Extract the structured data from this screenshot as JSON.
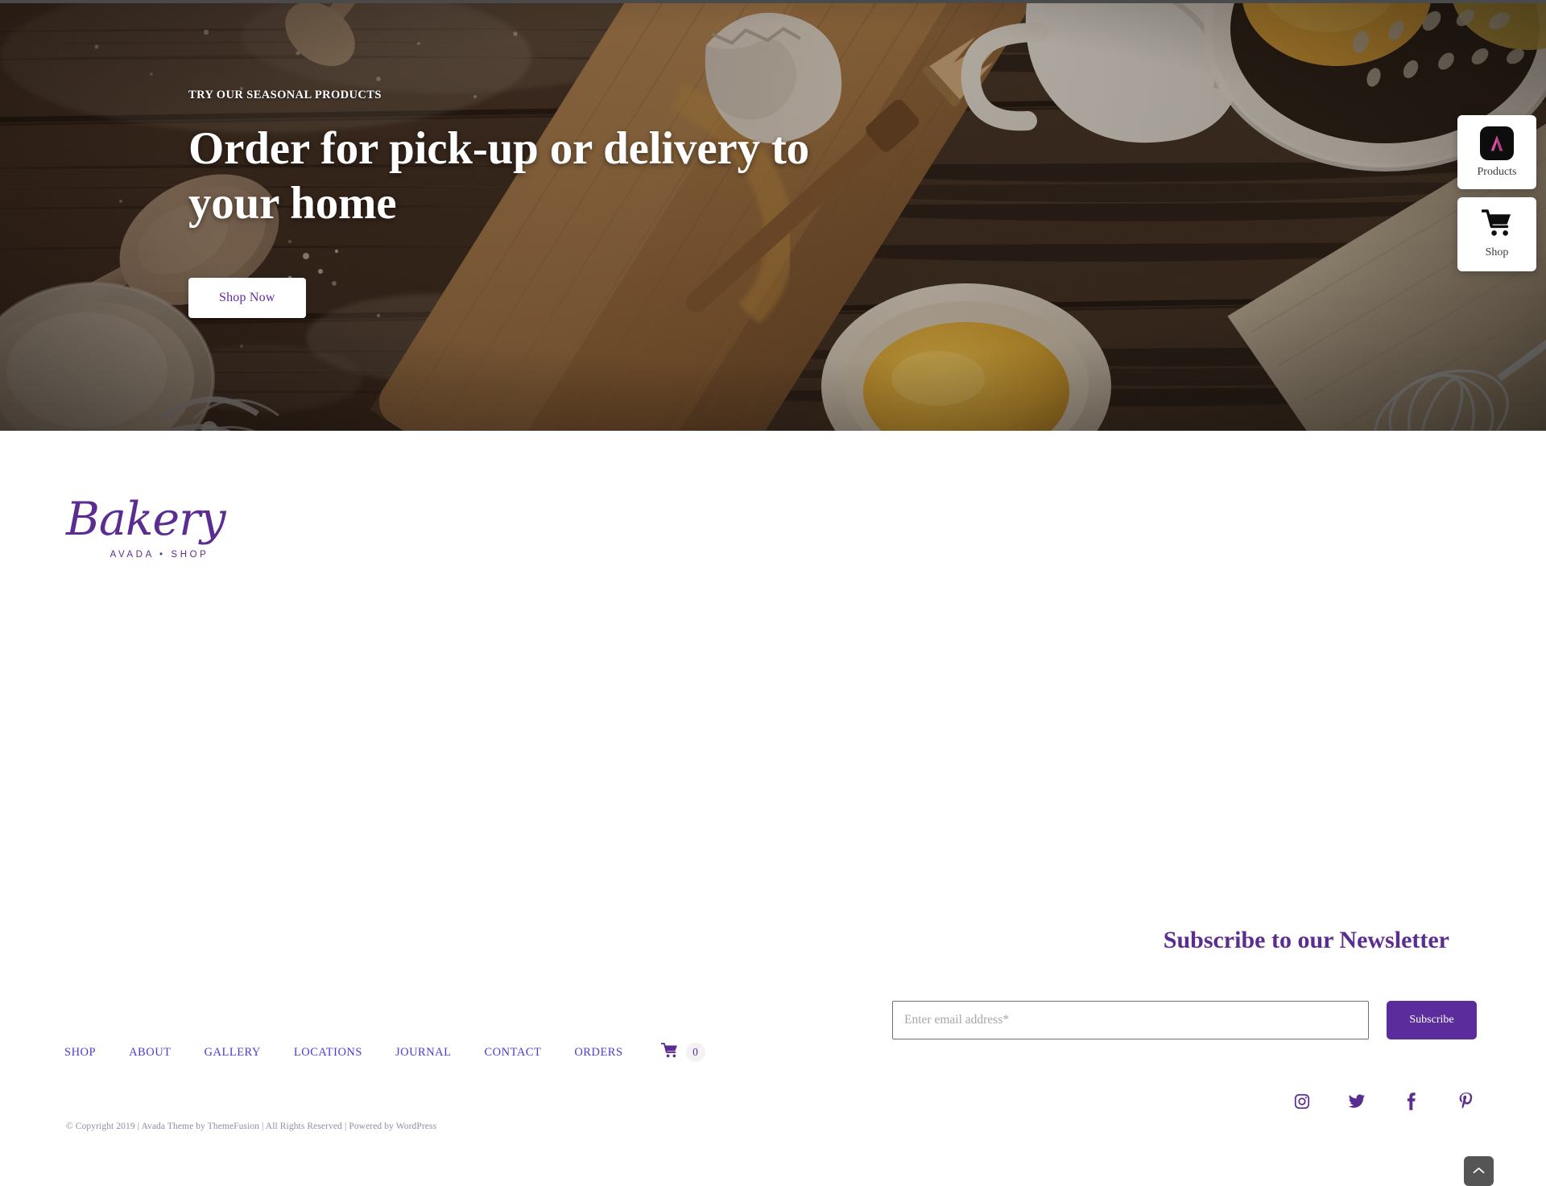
{
  "hero": {
    "eyebrow": "TRY OUR SEASONAL PRODUCTS",
    "title": "Order for pick-up or delivery to your home",
    "cta_label": "Shop Now",
    "background_description": "Dark rustic wooden table dusted with flour, wooden spoons, bamboo cutting board with pastry brush, cracked egg shell, bowl of egg yolk, glass flour jar, linen napkin, wire whisk and a colander with citrus"
  },
  "float_cards": [
    {
      "label": "Products",
      "icon": "avada-logo-icon"
    },
    {
      "label": "Shop",
      "icon": "shopping-cart-icon"
    }
  ],
  "footer": {
    "brand": {
      "name": "Bakery",
      "tagline": "AVADA • SHOP"
    },
    "nav": [
      {
        "label": "SHOP"
      },
      {
        "label": "ABOUT"
      },
      {
        "label": "GALLERY"
      },
      {
        "label": "LOCATIONS"
      },
      {
        "label": "JOURNAL"
      },
      {
        "label": "CONTACT"
      },
      {
        "label": "ORDERS"
      }
    ],
    "cart": {
      "icon": "shopping-cart-icon",
      "count": "0"
    },
    "copyright": "© Copyright 2019 | Avada Theme by ThemeFusion | All Rights Reserved | Powered by WordPress",
    "newsletter": {
      "heading": "Subscribe to our Newsletter",
      "placeholder": "Enter email address*",
      "button_label": "Subscribe"
    },
    "socials": [
      {
        "name": "instagram-icon"
      },
      {
        "name": "twitter-icon"
      },
      {
        "name": "facebook-icon"
      },
      {
        "name": "pinterest-icon"
      }
    ],
    "to_top": {
      "icon": "chevron-up-icon"
    }
  },
  "colors": {
    "brand_purple": "#5b2d90",
    "button_purple": "#5b2d9c",
    "nav_link": "#4a3bd6",
    "avada_pink": "#d94f9e",
    "copyright_gray": "#8d8fa3",
    "to_top_gray": "#555555"
  }
}
